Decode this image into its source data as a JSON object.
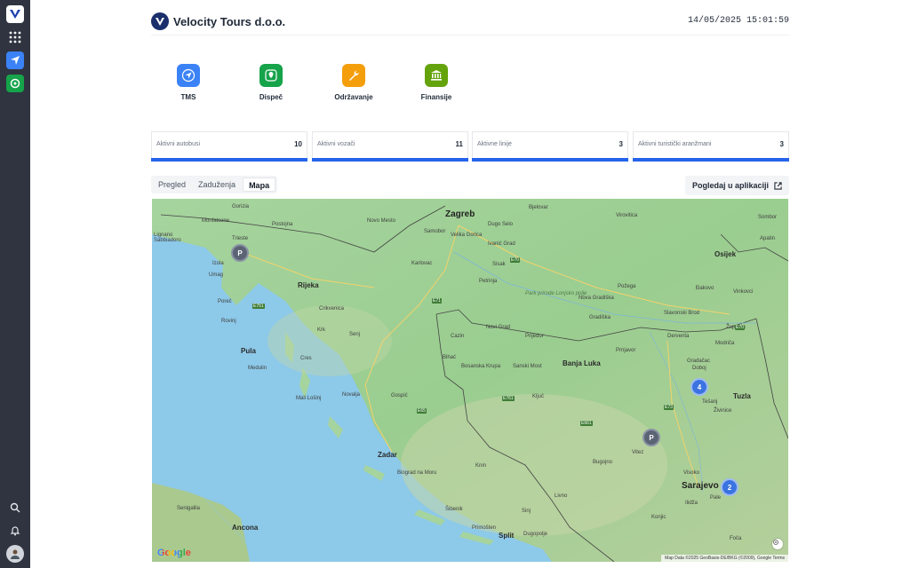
{
  "app": {
    "company_name": "Velocity Tours d.o.o.",
    "datetime": "14/05/2025 15:01:59",
    "logo_letter": "V"
  },
  "colors": {
    "rail": "#2f3440",
    "accent": "#2563eb",
    "tms": "#3b82f6",
    "dispatch": "#16a34a",
    "maintenance": "#f59e0b",
    "finance": "#65a30d"
  },
  "rail_icons": [
    {
      "name": "velocity-logo-icon"
    },
    {
      "name": "apps-grid-icon"
    },
    {
      "name": "tms-app-icon"
    },
    {
      "name": "dispatch-app-icon"
    },
    {
      "name": "search-icon"
    },
    {
      "name": "bell-icon"
    },
    {
      "name": "user-avatar"
    }
  ],
  "modules": [
    {
      "label": "TMS",
      "icon": "send-icon"
    },
    {
      "label": "Dispeč",
      "icon": "location-pin-icon"
    },
    {
      "label": "Održavanje",
      "icon": "wrench-icon"
    },
    {
      "label": "Finansije",
      "icon": "bank-icon"
    }
  ],
  "stats": [
    {
      "label": "Aktivni autobusi",
      "value": "10"
    },
    {
      "label": "Aktivni vozači",
      "value": "11"
    },
    {
      "label": "Aktivne linije",
      "value": "3"
    },
    {
      "label": "Aktivni turistički aranžmani",
      "value": "3"
    }
  ],
  "tabs": [
    {
      "label": "Pregled",
      "active": false
    },
    {
      "label": "Zaduženja",
      "active": false
    },
    {
      "label": "Mapa",
      "active": true
    }
  ],
  "open_in_app_label": "Pogledaj u aplikaciji",
  "map": {
    "cities": {
      "zagreb": "Zagreb",
      "rijeka": "Rijeka",
      "pula": "Pula",
      "zadar": "Zadar",
      "split": "Split",
      "sarajevo": "Sarajevo",
      "banja_luka": "Banja Luka",
      "osijek": "Osijek",
      "trieste": "Trieste",
      "tuzla": "Tuzla",
      "karlovac": "Karlovac",
      "sisak": "Sisak",
      "pozega": "Požega",
      "bihac": "Bihać",
      "gospic": "Gospić",
      "knin": "Knin",
      "livno": "Livno",
      "mostar_area": "Bugojno",
      "zenica": "Zenica",
      "doboj": "Doboj",
      "prijedor": "Prijedor",
      "vinkovci": "Vinkovci",
      "sibenik": "Šibenik",
      "makarska": "Makarska",
      "ancona": "Ancona",
      "senigallia": "Senigallia",
      "novo_mesto": "Novo Mesto",
      "samobor": "Samobor",
      "bjelovar": "Bjelovar",
      "virovitica": "Virovitica",
      "slavonski_brod": "Slavonski Brod",
      "porec": "Poreč",
      "rovinj": "Rovinj",
      "krk": "Krk",
      "cres": "Cres",
      "mali_losinj": "Mali Lošinj",
      "novalja": "Novalja",
      "senj": "Senj",
      "crikvenica": "Crikvenica",
      "kostajnica": "Cazin",
      "visoko": "Visoko",
      "vitez": "Vitez",
      "ilidza": "Ilidža",
      "pale": "Pale",
      "konjic": "Konjic",
      "foca": "Foča",
      "brcko": "Županja",
      "gradacac": "Gradačac",
      "modrica": "Modriča",
      "tesanj": "Tešanj",
      "zivinice": "Živinice",
      "biograd": "Biograd na Moru",
      "dugopolje": "Dugopolje",
      "primosten": "Primošten",
      "sinj": "Sinj",
      "gorizia": "Gorizia",
      "monfalcone": "Monfalcone",
      "postojna": "Postojna",
      "izola": "Izola",
      "umag": "Umag",
      "medulin": "Medulin",
      "velika_gorica": "Velika Gorica",
      "ivanic_grad": "Ivanić Grad",
      "petrinja": "Petrinja",
      "nova_gradiska": "Nova Gradiška",
      "gradiska": "Gradiška",
      "novi_grad": "Novi Grad",
      "sanski_most": "Sanski Most",
      "kljuc": "Ključ",
      "derventa": "Derventa",
      "prnjavor": "Prnjavor",
      "dakovo": "Đakovo",
      "sombor": "Sombor",
      "apatin": "Apatin",
      "bosanska_krupa": "Bosanska Krupa",
      "park": "Park prirode Lonjsko polje",
      "dugo_selo": "Dugo Selo",
      "lignano": "Lignano Sabbiadoro"
    },
    "markers": [
      {
        "type": "parking",
        "label": "P"
      },
      {
        "type": "parking",
        "label": "P"
      },
      {
        "type": "cluster",
        "label": "4"
      },
      {
        "type": "cluster",
        "label": "2"
      }
    ],
    "google_label": "Google",
    "attribution": "Map Data ©2025 GeoBasis-DE/BKG (©2009), Google   Terms"
  }
}
